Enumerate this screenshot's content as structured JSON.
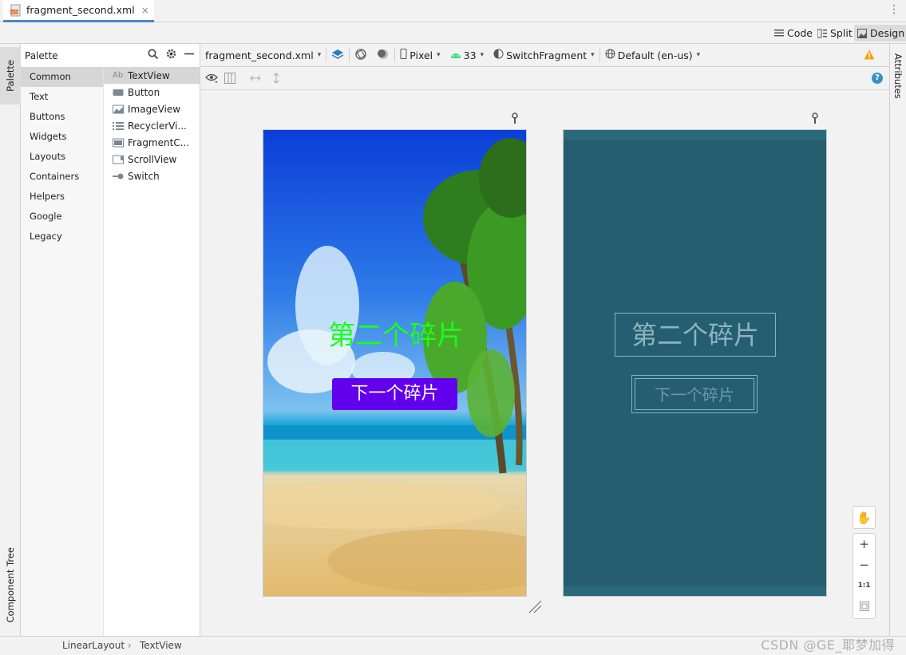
{
  "tab": {
    "filename": "fragment_second.xml",
    "close_glyph": "×"
  },
  "modes": {
    "code": "Code",
    "split": "Split",
    "design": "Design",
    "active": "Design"
  },
  "left_strip": {
    "palette": "Palette",
    "component_tree": "Component Tree"
  },
  "palette": {
    "title": "Palette",
    "categories": [
      "Common",
      "Text",
      "Buttons",
      "Widgets",
      "Layouts",
      "Containers",
      "Helpers",
      "Google",
      "Legacy"
    ],
    "selected_category": "Common",
    "widgets": [
      {
        "label": "TextView",
        "icon": "textview-icon",
        "glyph": "Ab"
      },
      {
        "label": "Button",
        "icon": "button-icon",
        "glyph": ""
      },
      {
        "label": "ImageView",
        "icon": "image-icon",
        "glyph": ""
      },
      {
        "label": "RecyclerVi...",
        "icon": "list-icon",
        "glyph": ""
      },
      {
        "label": "FragmentC...",
        "icon": "fragment-icon",
        "glyph": ""
      },
      {
        "label": "ScrollView",
        "icon": "scroll-icon",
        "glyph": ""
      },
      {
        "label": "Switch",
        "icon": "switch-icon",
        "glyph": ""
      }
    ],
    "selected_widget": "TextView"
  },
  "design_toolbar": {
    "file": "fragment_second.xml",
    "device": "Pixel",
    "api": "33",
    "theme": "SwitchFragment",
    "locale": "Default (en-us)"
  },
  "attributes_strip": {
    "label": "Attributes"
  },
  "preview": {
    "title_text": "第二个碎片",
    "button_text": "下一个碎片",
    "title_color": "#19ff19",
    "button_color": "#6200ee",
    "blueprint_bg": "#245e70"
  },
  "zoom": {
    "plus": "+",
    "minus": "−",
    "one_to_one": "1:1"
  },
  "status": {
    "crumbs": [
      "LinearLayout",
      "TextView"
    ],
    "sep": "›"
  },
  "watermark": "CSDN @GE_耶梦加得"
}
